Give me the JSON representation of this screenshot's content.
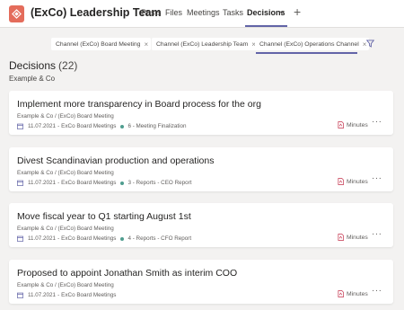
{
  "header": {
    "team_name": "(ExCo) Leadership Team",
    "tabs": [
      "Posts",
      "Files",
      "Meetings",
      "Tasks",
      "Decisions"
    ],
    "active_tab": "Decisions",
    "add_tab": "+"
  },
  "filters": {
    "chips": [
      "Channel (ExCo) Board Meeting",
      "Channel (ExCo) Leadership Team",
      "Channel (ExCo) Operations Channel"
    ],
    "remove_glyph": "×"
  },
  "section": {
    "title": "Decisions",
    "count": "(22)",
    "subtitle": "Example & Co"
  },
  "decisions": [
    {
      "title": "Implement more transparency in Board process for the org",
      "path": "Example & Co / (ExCo) Board Meeting",
      "date": "11.07.2021",
      "meeting": "ExCo Board Meetings",
      "agenda": "6 - Meeting Finalization",
      "attachment": "Minutes"
    },
    {
      "title": "Divest Scandinavian production and operations",
      "path": "Example & Co / (ExCo) Board Meeting",
      "date": "11.07.2021",
      "meeting": "ExCo Board Meetings",
      "agenda": "3 - Reports - CEO Report",
      "attachment": "Minutes"
    },
    {
      "title": "Move fiscal year to Q1 starting August 1st",
      "path": "Example & Co / (ExCo) Board Meeting",
      "date": "11.07.2021",
      "meeting": "ExCo Board Meetings",
      "agenda": "4 - Reports - CFO Report",
      "attachment": "Minutes"
    },
    {
      "title": "Proposed to appoint Jonathan Smith as interim COO",
      "path": "Example & Co / (ExCo) Board Meeting",
      "date": "11.07.2021",
      "meeting": "ExCo Board Meetings",
      "agenda": "",
      "attachment": "Minutes"
    }
  ],
  "more_glyph": "···",
  "colors": {
    "accent": "#6264a7",
    "avatar": "#e46c5b",
    "agenda_dot": "#4f9d8f"
  },
  "icons": [
    "team-logo-icon",
    "chevron-down-icon",
    "plus-icon",
    "filter-icon",
    "calendar-icon",
    "pdf-icon",
    "more-icon",
    "close-icon"
  ]
}
